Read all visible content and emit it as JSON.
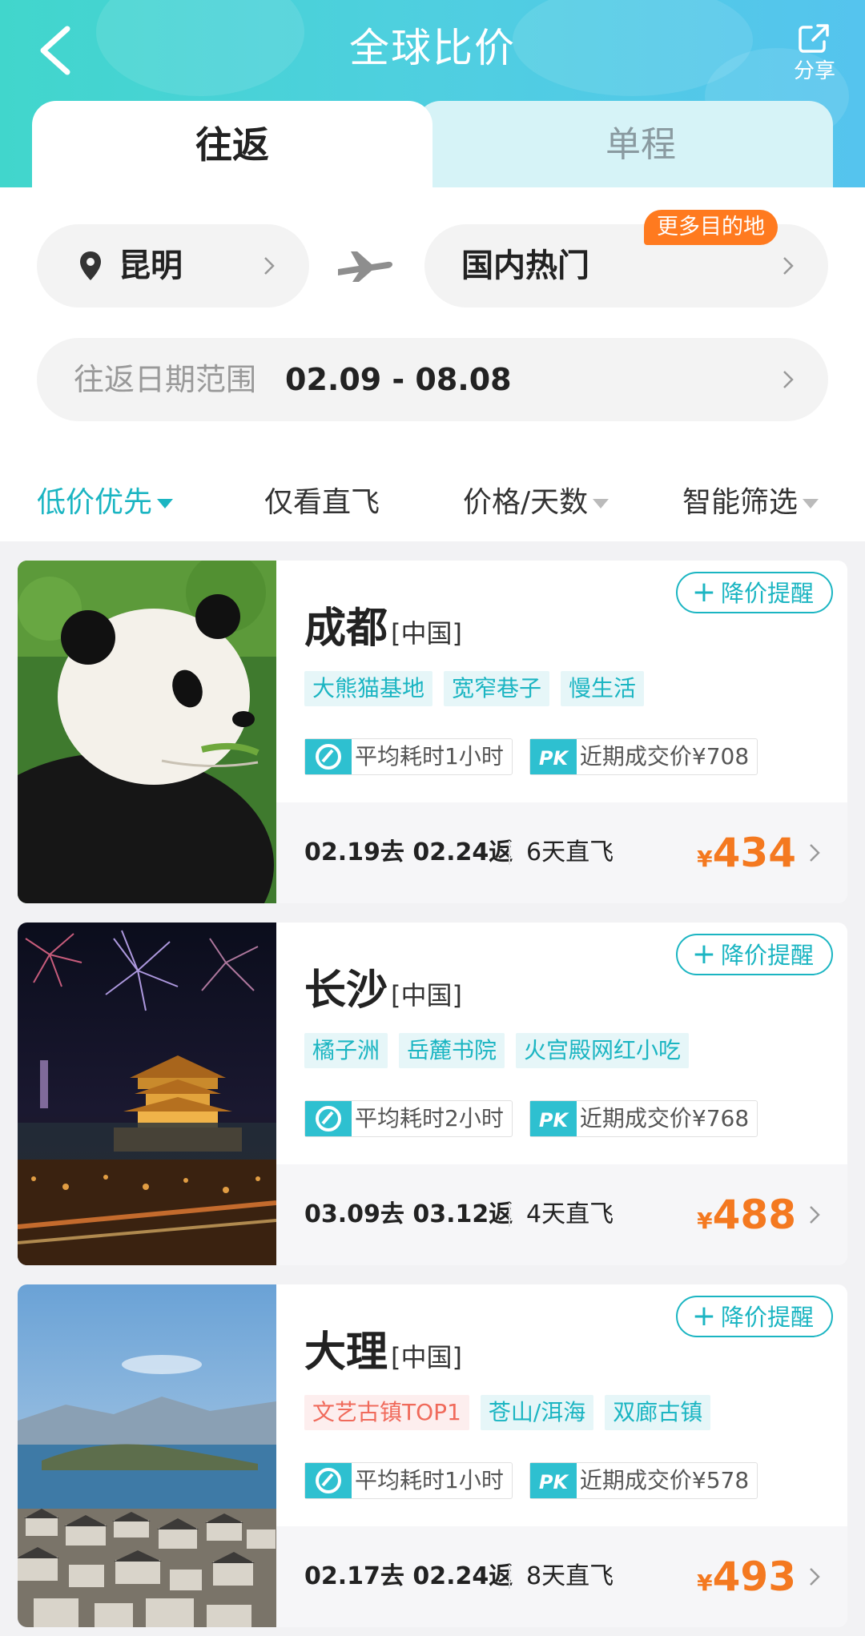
{
  "header": {
    "title": "全球比价",
    "share_label": "分享"
  },
  "tabs": [
    {
      "label": "往返",
      "active": true
    },
    {
      "label": "单程",
      "active": false
    }
  ],
  "search": {
    "from_city": "昆明",
    "to_city": "国内热门",
    "more_badge": "更多目的地",
    "date_label": "往返日期范围",
    "date_value": "02.09 - 08.08"
  },
  "sort": [
    {
      "label": "低价优先",
      "active": true,
      "has_arrow": true
    },
    {
      "label": "仅看直飞",
      "active": false,
      "has_arrow": false
    },
    {
      "label": "价格/天数",
      "active": false,
      "has_arrow": true
    },
    {
      "label": "智能筛选",
      "active": false,
      "has_arrow": true
    }
  ],
  "cards": [
    {
      "city": "成都",
      "country": "[中国]",
      "remind": "降价提醒",
      "tags": [
        {
          "text": "大熊猫基地",
          "hot": false
        },
        {
          "text": "宽窄巷子",
          "hot": false
        },
        {
          "text": "慢生活",
          "hot": false
        }
      ],
      "avg_time": "平均耗时1小时",
      "recent_price": "近期成交价¥708",
      "dates": "02.19去 02.24返",
      "days": "6天直飞",
      "currency": "¥",
      "price": "434",
      "image": "panda"
    },
    {
      "city": "长沙",
      "country": "[中国]",
      "remind": "降价提醒",
      "tags": [
        {
          "text": "橘子洲",
          "hot": false
        },
        {
          "text": "岳麓书院",
          "hot": false
        },
        {
          "text": "火宫殿网红小吃",
          "hot": false
        }
      ],
      "avg_time": "平均耗时2小时",
      "recent_price": "近期成交价¥768",
      "dates": "03.09去 03.12返",
      "days": "4天直飞",
      "currency": "¥",
      "price": "488",
      "image": "fireworks-pavilion"
    },
    {
      "city": "大理",
      "country": "[中国]",
      "remind": "降价提醒",
      "tags": [
        {
          "text": "文艺古镇TOP1",
          "hot": true
        },
        {
          "text": "苍山/洱海",
          "hot": false
        },
        {
          "text": "双廊古镇",
          "hot": false
        }
      ],
      "avg_time": "平均耗时1小时",
      "recent_price": "近期成交价¥578",
      "dates": "02.17去 02.24返",
      "days": "8天直飞",
      "currency": "¥",
      "price": "493",
      "image": "lake-town"
    }
  ],
  "icons": {
    "back": "back-arrow-icon",
    "share": "share-icon",
    "location": "location-pin-icon",
    "plane": "airplane-icon",
    "clock": "clock-icon",
    "pk": "pk-icon",
    "chevron": "chevron-right-icon"
  },
  "colors": {
    "accent": "#1bb5c2",
    "price": "#f47920",
    "badge": "#ff7a1f",
    "hot_tag": "#f06a5b"
  }
}
